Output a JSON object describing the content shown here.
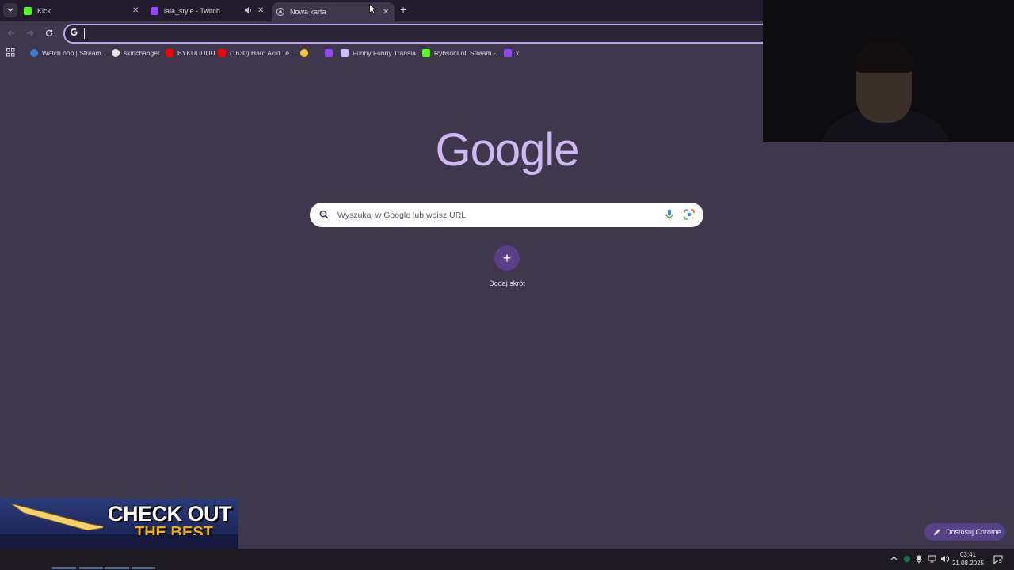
{
  "tabs": [
    {
      "title": "Kick",
      "favicon": "kick-icon",
      "color": "#53fc18"
    },
    {
      "title": "lala_style - Twitch",
      "favicon": "twitch-icon",
      "color": "#9146ff",
      "audio": true
    },
    {
      "title": "Nowa karta",
      "favicon": "chrome-icon",
      "active": true
    }
  ],
  "omnibox": {
    "value": ""
  },
  "bookmarks": [
    {
      "label": "Watch ooo | Stream...",
      "icon": "stream-icon",
      "color": "#3a7bd5"
    },
    {
      "label": "skinchanger",
      "icon": "github-icon",
      "color": "#e6e6e6"
    },
    {
      "label": "BYKUUUUU",
      "icon": "youtube-icon",
      "color": "#ff0000"
    },
    {
      "label": "(1630) Hard Acid Te...",
      "icon": "youtube-icon",
      "color": "#ff0000"
    },
    {
      "label": "",
      "icon": "emoji-icon",
      "color": "#f7c531"
    },
    {
      "label": "",
      "icon": "twitch-icon",
      "color": "#9146ff"
    },
    {
      "label": "Funny Funny Transla...",
      "icon": "translate-icon",
      "color": "#c7c0ff"
    },
    {
      "label": "RybsonLoL Stream -...",
      "icon": "kick-icon",
      "color": "#53fc18"
    },
    {
      "label": "x",
      "icon": "twitch-icon",
      "color": "#9146ff"
    }
  ],
  "ntp": {
    "logo": "Google",
    "search_placeholder": "Wyszukaj w Google lub wpisz URL",
    "add_shortcut": "Dodaj skrót",
    "customize": "Dostosuj Chrome"
  },
  "ad": {
    "line1": "CHECK OUT",
    "line2": "THE BEST"
  },
  "taskbar": {
    "time": "03:41",
    "date": "21.08.2025",
    "notifications": "5"
  },
  "colors": {
    "accent": "#cdb8f0",
    "background": "#3f374c",
    "tabstrip": "#221c2c"
  }
}
